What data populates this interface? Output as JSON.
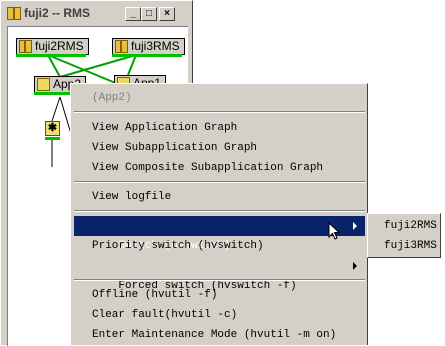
{
  "window": {
    "title": "fuji2 -- RMS",
    "controls": {
      "minimize": "_",
      "maximize": "□",
      "close": "×"
    }
  },
  "graph": {
    "nodes": [
      {
        "label": "fuji2RMS",
        "icon": "host-icon"
      },
      {
        "label": "fuji3RMS",
        "icon": "host-icon"
      },
      {
        "label": "App2",
        "icon": "app-icon"
      },
      {
        "label": "App1",
        "icon": "app-icon"
      }
    ],
    "mini_node_symbol": "✱",
    "colors": {
      "online": "#00c000",
      "link": "#00a000"
    }
  },
  "context_menu": {
    "header": "(App2)",
    "groups": [
      [
        "View Application Graph",
        "View Subapplication Graph",
        "View Composite Subapplication Graph"
      ],
      [
        "View logfile"
      ],
      [
        "Switch (hvswitch)",
        "Priority switch (hvswitch)",
        "Forced switch (hvswitch -f)"
      ],
      [
        "Offline (hvutil -f)",
        "Clear fault(hvutil -c)",
        "Enter Maintenance Mode (hvutil -m on)"
      ]
    ],
    "selected": "Switch (hvswitch)",
    "highlight_color": "#0a246a"
  },
  "submenu": {
    "items": [
      "fuji2RMS",
      "fuji3RMS"
    ]
  }
}
